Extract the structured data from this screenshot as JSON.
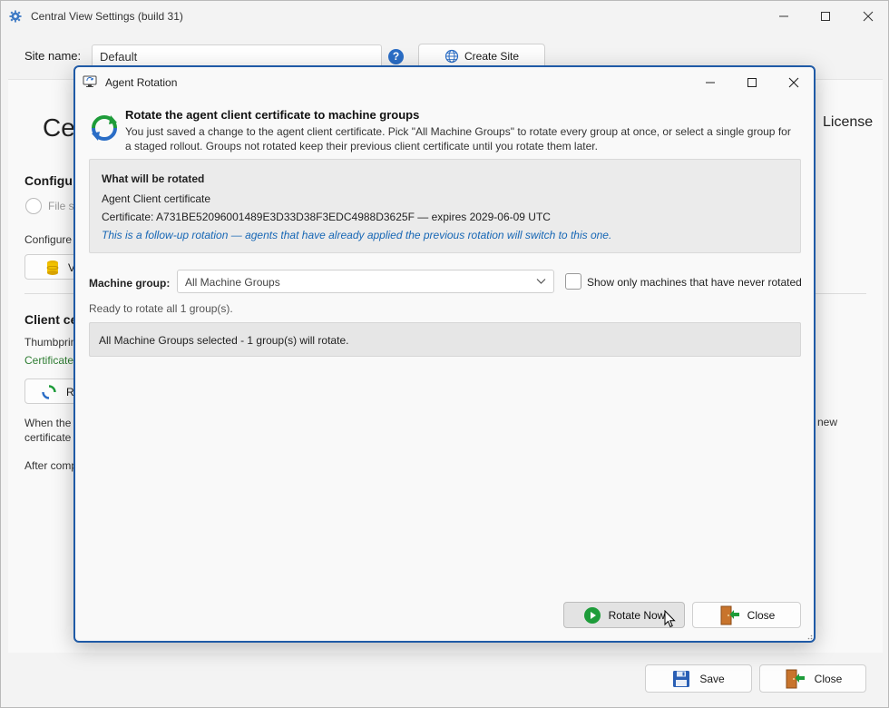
{
  "window": {
    "title": "Central View Settings (build 31)",
    "icon": "gear-icon"
  },
  "site": {
    "label": "Site name:",
    "value": "Default",
    "help_label": "?",
    "create_label": "Create Site"
  },
  "background": {
    "heading": "Ce",
    "license": "License",
    "config_heading": "Configu",
    "file_option": "File s",
    "configure_text": "Configure",
    "db_button": "V",
    "client_heading": "Client ce",
    "thumbprint": "Thumbprin",
    "certificate": "Certificate",
    "rotate_button": "R",
    "when_text_1": "When the",
    "when_text_2": "certificate",
    "new_text": "new",
    "after_text": "After comp"
  },
  "footer": {
    "save_label": "Save",
    "close_label": "Close"
  },
  "dialog": {
    "title": "Agent Rotation",
    "heading": "Rotate the agent client certificate to machine groups",
    "description": "You just saved a change to the agent client certificate. Pick \"All Machine Groups\" to rotate every group at once, or select a single group for a staged rollout. Groups not rotated keep their previous client certificate until you rotate them later.",
    "info": {
      "title": "What will be rotated",
      "item": "Agent Client certificate",
      "certificate": "Certificate: A731BE52096001489E3D33D38F3EDC4988D3625F — expires 2029-06-09 UTC",
      "note": "This is a follow-up rotation — agents that have already applied the previous rotation will switch to this one."
    },
    "machine_group": {
      "label": "Machine group:",
      "selected": "All Machine Groups",
      "checkbox_label": "Show only machines that have never rotated",
      "checkbox_checked": false
    },
    "status": "Ready to rotate all 1 group(s).",
    "selection_summary": "All Machine Groups selected - 1 group(s) will rotate.",
    "rotate_label": "Rotate Now",
    "close_label": "Close"
  },
  "colors": {
    "dialog_border": "#1f5aa6",
    "note_blue": "#1767b5",
    "cert_green": "#2e7d32",
    "rotate_green": "#1e9c3a"
  }
}
